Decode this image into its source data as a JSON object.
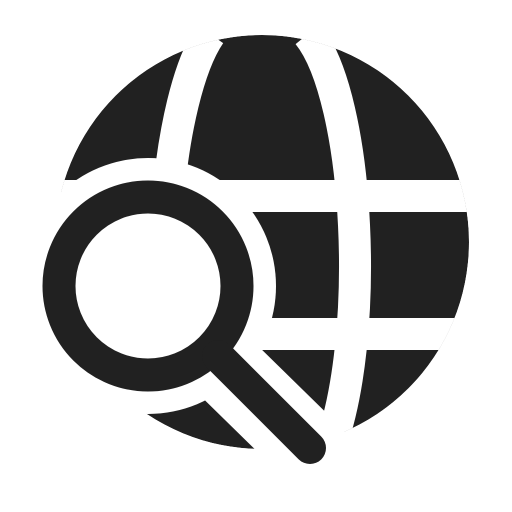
{
  "icon": {
    "name": "globe-search-icon",
    "parts": [
      "globe-icon",
      "magnifying-glass-icon"
    ],
    "colors": {
      "foreground": "#212121",
      "background": "#ffffff"
    }
  }
}
